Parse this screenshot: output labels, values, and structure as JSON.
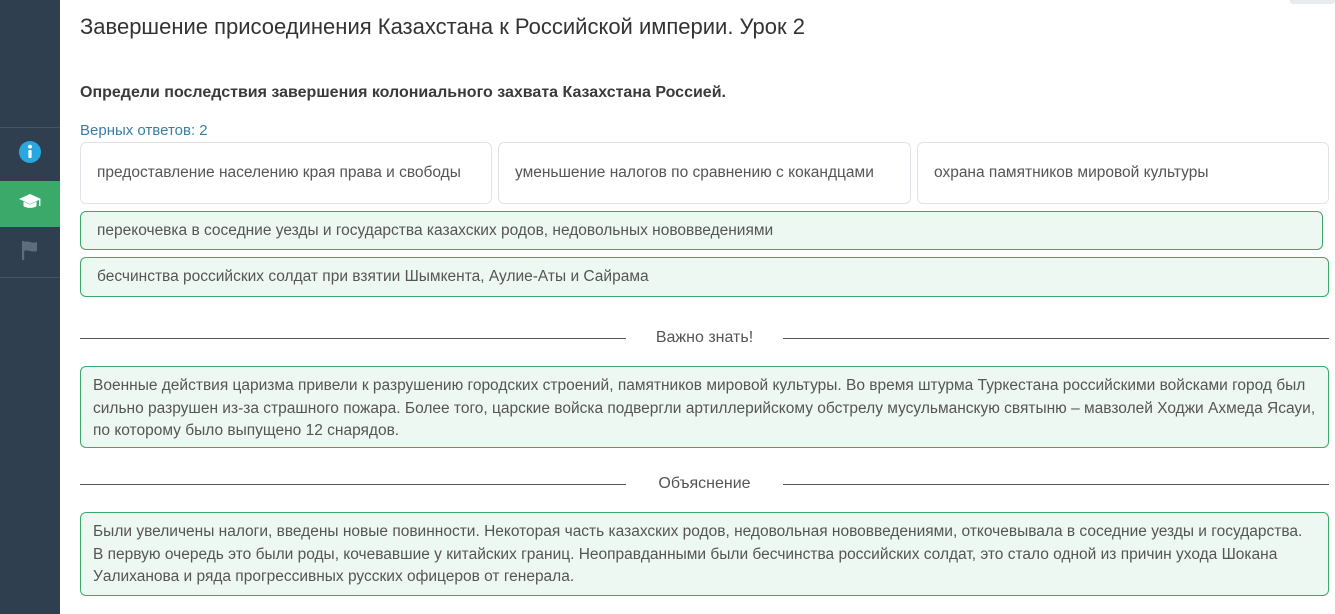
{
  "title": "Завершение присоединения Казахстана к Российской империи. Урок 2",
  "question": "Определи последствия завершения колониального захвата Казахстана Россией.",
  "correct_answers": "Верных ответов: 2",
  "sidebar": {
    "items": [
      {
        "icon": "info-icon"
      },
      {
        "icon": "graduation-cap-icon",
        "active": true
      },
      {
        "icon": "flag-icon"
      }
    ],
    "active_color": "#3aa96a",
    "background": "#2f3f4f"
  },
  "options": [
    {
      "text": "предоставление населению края права и свободы",
      "selected": false
    },
    {
      "text": "уменьшение налогов по сравнению с кокандцами",
      "selected": false
    },
    {
      "text": "охрана памятников мировой культуры",
      "selected": false
    }
  ],
  "selected_answers": [
    {
      "text": "перекочевка в соседние уезды и государства казахских родов, недовольных нововведениями"
    },
    {
      "text": "бесчинства российских солдат при взятии Шымкента, Аулие-Аты и Сайрама"
    }
  ],
  "important": {
    "heading": "Важно знать!",
    "text": "Военные действия царизма привели к разрушению городских строений, памятников мировой культуры. Во время штурма Туркестана российскими войсками город был сильно разрушен из-за страшного пожара. Более того, царские войска подвергли артиллерийскому обстрелу мусульманскую святыню – мавзолей Ходжи Ахмеда Ясауи, по которому было выпущено 12 снарядов."
  },
  "explanation": {
    "heading": "Объяснение",
    "text": "Были увеличены налоги, введены новые повинности. Некоторая часть казахских родов, недовольная нововведениями, откочевывала в соседние уезды и государства. В первую очередь это были роды, кочевавшие у китайских границ. Неоправданными были бесчинства российских солдат, это стало одной из причин ухода Шокана Уалиханова и ряда прогрессивных русских офицеров от генерала."
  }
}
